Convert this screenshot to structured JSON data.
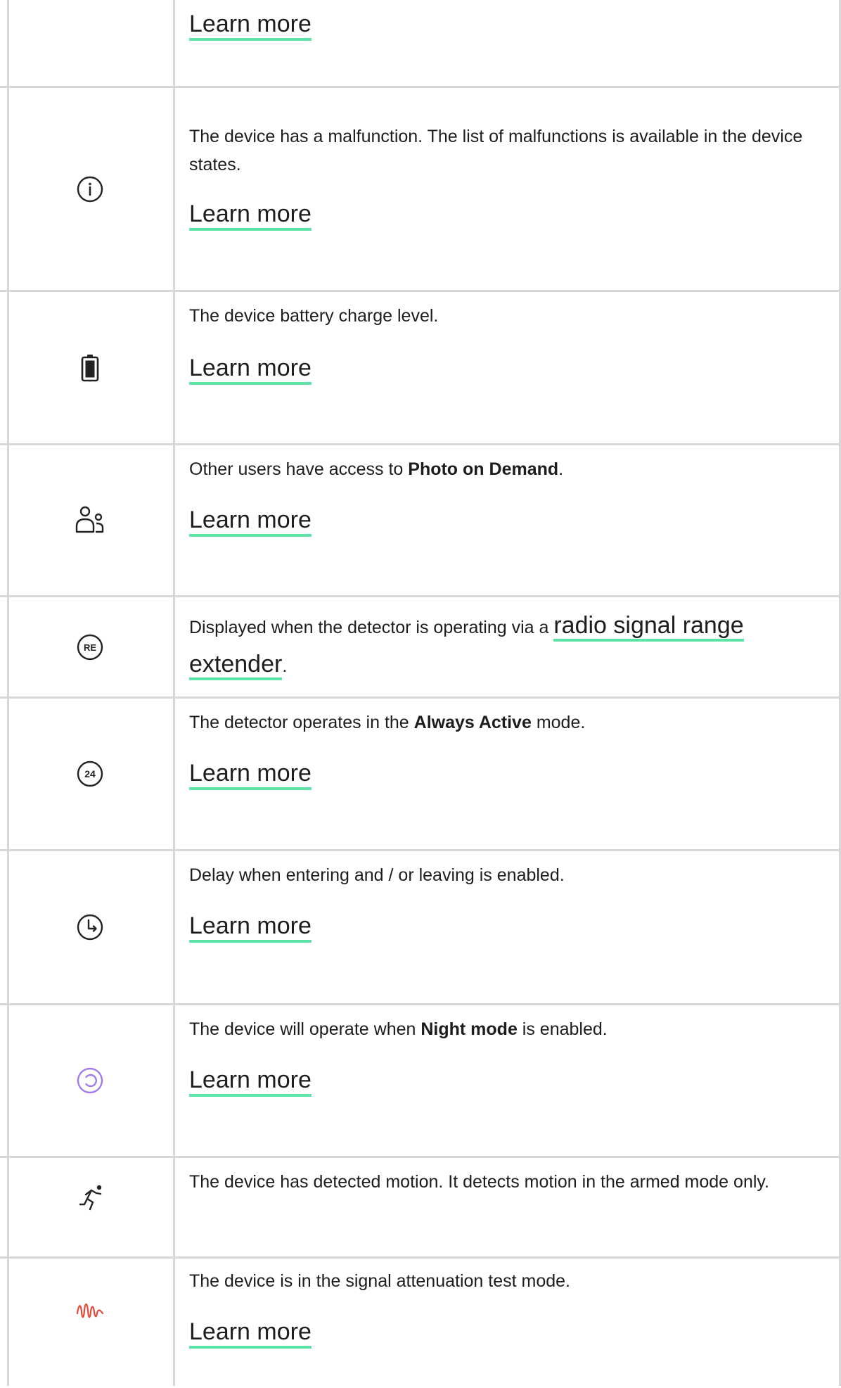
{
  "rows": [
    {
      "id": "top",
      "link": "Learn more"
    },
    {
      "id": "malfunction",
      "icon": "info-icon",
      "text": "The device has a malfunction. The list of malfunctions is available in the device states.",
      "link": "Learn more"
    },
    {
      "id": "battery",
      "icon": "battery-icon",
      "text": "The device battery charge level.",
      "link": "Learn more"
    },
    {
      "id": "photo",
      "icon": "users-icon",
      "text_before": "Other users have access to ",
      "text_bold": "Photo on Demand",
      "text_after": ".",
      "link": "Learn more"
    },
    {
      "id": "range-extender",
      "icon": "re-icon",
      "icon_text": "RE",
      "text_before": "Displayed when the detector is operating via a ",
      "inline_link": "radio signal range extender",
      "text_after": "."
    },
    {
      "id": "always-active",
      "icon": "24h-icon",
      "icon_text": "24",
      "text_before": "The detector operates in the ",
      "text_bold": "Always Active",
      "text_after": " mode.",
      "link": "Learn more"
    },
    {
      "id": "delay",
      "icon": "clock-delay-icon",
      "text": "Delay when entering and / or leaving is enabled.",
      "link": "Learn more"
    },
    {
      "id": "night-mode",
      "icon": "night-mode-icon",
      "text_before": "The device will operate when ",
      "text_bold": "Night mode",
      "text_after": " is enabled.",
      "link": "Learn more"
    },
    {
      "id": "motion",
      "icon": "motion-icon",
      "text": "The device has detected motion. It detects motion in the armed mode only."
    },
    {
      "id": "attenuation",
      "icon": "signal-wave-icon",
      "text": "The device is in the signal attenuation test mode.",
      "link": "Learn more"
    }
  ],
  "colors": {
    "link_underline": "#5ee3a6",
    "night_mode_icon": "#a27cf0",
    "attenuation_icon": "#e5483c",
    "border": "#d7d7d7",
    "text": "#1d1d1d"
  }
}
